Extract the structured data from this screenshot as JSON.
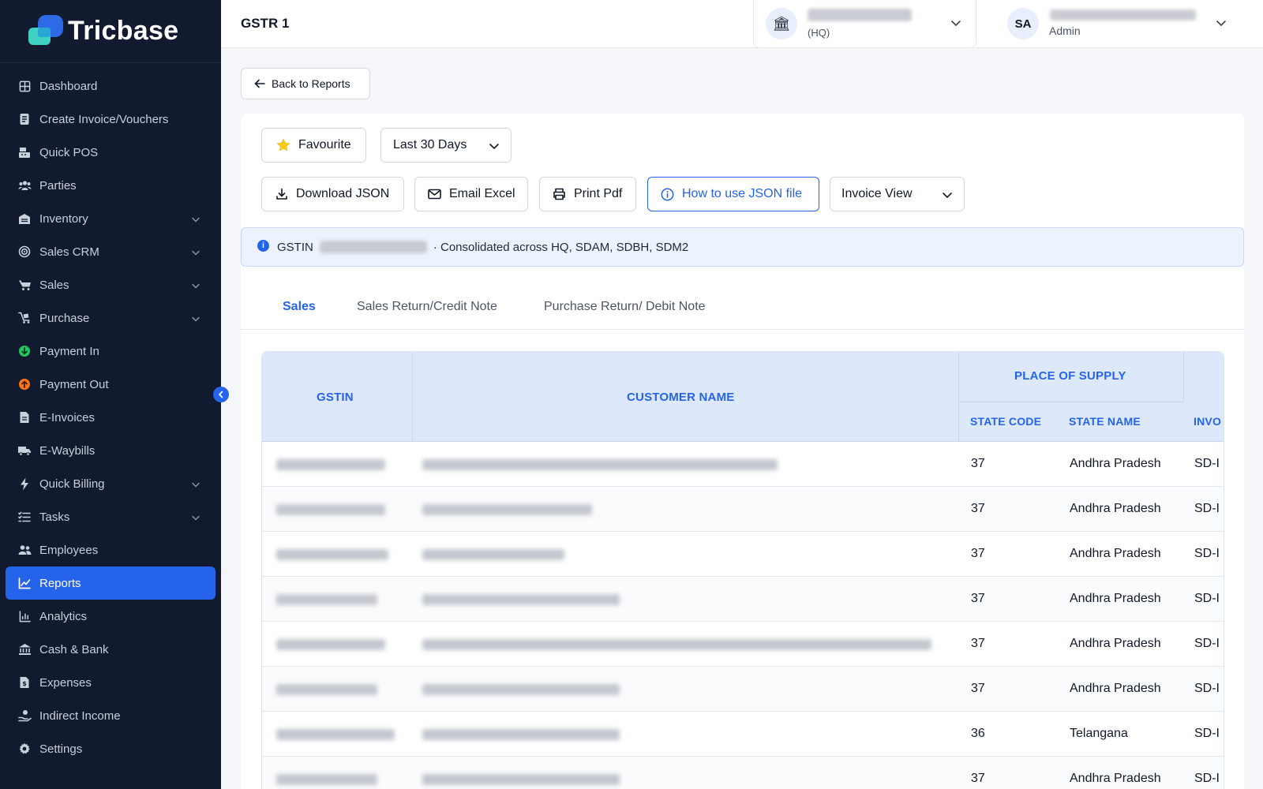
{
  "brand": {
    "name": "Tricbase"
  },
  "sidebar": {
    "items": [
      {
        "label": "Dashboard",
        "icon": "dashboard-icon",
        "expandable": false
      },
      {
        "label": "Create Invoice/Vouchers",
        "icon": "invoice-icon",
        "expandable": false
      },
      {
        "label": "Quick POS",
        "icon": "pos-icon",
        "expandable": false
      },
      {
        "label": "Parties",
        "icon": "users-icon",
        "expandable": false
      },
      {
        "label": "Inventory",
        "icon": "inventory-icon",
        "expandable": true
      },
      {
        "label": "Sales CRM",
        "icon": "target-icon",
        "expandable": true
      },
      {
        "label": "Sales",
        "icon": "cart-icon",
        "expandable": true
      },
      {
        "label": "Purchase",
        "icon": "purchase-icon",
        "expandable": true
      },
      {
        "label": "Payment In",
        "icon": "payment-in-icon",
        "expandable": false
      },
      {
        "label": "Payment Out",
        "icon": "payment-out-icon",
        "expandable": false
      },
      {
        "label": "E-Invoices",
        "icon": "e-invoice-icon",
        "expandable": false
      },
      {
        "label": "E-Waybills",
        "icon": "truck-icon",
        "expandable": false
      },
      {
        "label": "Quick Billing",
        "icon": "bolt-icon",
        "expandable": true
      },
      {
        "label": "Tasks",
        "icon": "tasks-icon",
        "expandable": true
      },
      {
        "label": "Employees",
        "icon": "employees-icon",
        "expandable": false
      },
      {
        "label": "Reports",
        "icon": "reports-icon",
        "expandable": false,
        "active": true
      },
      {
        "label": "Analytics",
        "icon": "analytics-icon",
        "expandable": false
      },
      {
        "label": "Cash & Bank",
        "icon": "bank-icon",
        "expandable": false
      },
      {
        "label": "Expenses",
        "icon": "expenses-icon",
        "expandable": false
      },
      {
        "label": "Indirect Income",
        "icon": "income-icon",
        "expandable": false
      },
      {
        "label": "Settings",
        "icon": "gear-icon",
        "expandable": false
      }
    ]
  },
  "header": {
    "title": "GSTR 1",
    "branch": {
      "sub": "(HQ)"
    },
    "user": {
      "initials": "SA",
      "role": "Admin"
    }
  },
  "actions": {
    "back": "Back to Reports",
    "favourite": "Favourite",
    "period": "Last 30 Days",
    "download_json": "Download JSON",
    "email_excel": "Email Excel",
    "print_pdf": "Print Pdf",
    "how_to": "How to use JSON file",
    "view": "Invoice View"
  },
  "info": {
    "prefix": "GSTIN",
    "suffix": "· Consolidated across HQ, SDAM, SDBH, SDM2"
  },
  "tabs": [
    {
      "label": "Sales",
      "active": true
    },
    {
      "label": "Sales Return/Credit Note",
      "active": false
    },
    {
      "label": "Purchase Return/ Debit Note",
      "active": false
    }
  ],
  "table": {
    "headers": {
      "gstin": "GSTIN",
      "customer": "CUSTOMER NAME",
      "place_of_supply": "PLACE OF SUPPLY",
      "state_code": "STATE CODE",
      "state_name": "STATE NAME",
      "invoice": "INVO"
    },
    "rows": [
      {
        "state_code": "37",
        "state_name": "Andhra Pradesh",
        "invoice": "SD-I"
      },
      {
        "state_code": "37",
        "state_name": "Andhra Pradesh",
        "invoice": "SD-I"
      },
      {
        "state_code": "37",
        "state_name": "Andhra Pradesh",
        "invoice": "SD-I"
      },
      {
        "state_code": "37",
        "state_name": "Andhra Pradesh",
        "invoice": "SD-I"
      },
      {
        "state_code": "37",
        "state_name": "Andhra Pradesh",
        "invoice": "SD-I"
      },
      {
        "state_code": "37",
        "state_name": "Andhra Pradesh",
        "invoice": "SD-I"
      },
      {
        "state_code": "36",
        "state_name": "Telangana",
        "invoice": "SD-I"
      },
      {
        "state_code": "37",
        "state_name": "Andhra Pradesh",
        "invoice": "SD-I"
      }
    ]
  },
  "colors": {
    "accent": "#2563eb",
    "sidebar_bg": "#111a2e",
    "header_bg": "#dde9fb"
  }
}
